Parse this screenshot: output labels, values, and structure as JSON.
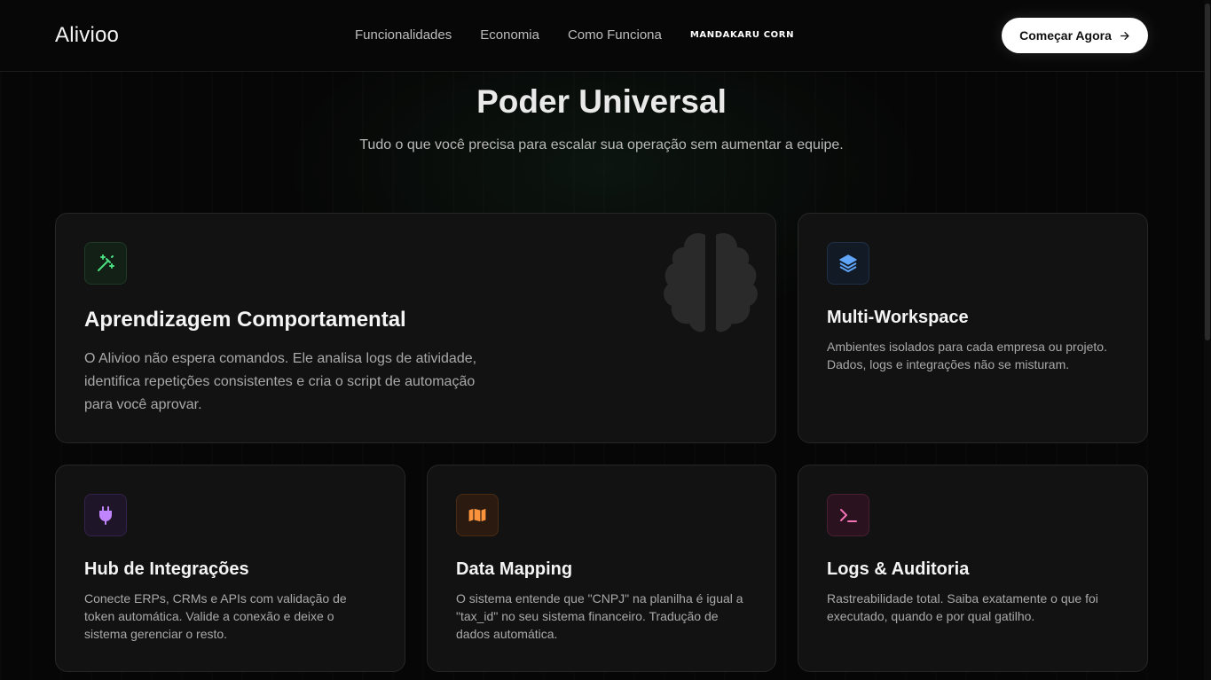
{
  "header": {
    "logo": "Alivioo",
    "nav": [
      {
        "label": "Funcionalidades"
      },
      {
        "label": "Economia"
      },
      {
        "label": "Como Funciona"
      },
      {
        "label": "MANDAKARU CORN"
      }
    ],
    "cta_label": "Começar Agora",
    "cta_icon": "arrow-right-icon"
  },
  "hero": {
    "title": "Poder Universal",
    "subtitle": "Tudo o que você precisa para escalar sua operação sem aumentar a equipe."
  },
  "cards": [
    {
      "title": "Aprendizagem Comportamental",
      "description": "O Alivioo não espera comandos. Ele analisa logs de atividade, identifica repetições consistentes e cria o script de automação para você aprovar.",
      "icon": "magic-wand-icon",
      "color": "#4ade80"
    },
    {
      "title": "Multi-Workspace",
      "description": "Ambientes isolados para cada empresa ou projeto. Dados, logs e integrações não se misturam.",
      "icon": "layers-icon",
      "color": "#60a5fa"
    },
    {
      "title": "Hub de Integrações",
      "description": "Conecte ERPs, CRMs e APIs com validação de token automática. Valide a conexão e deixe o sistema gerenciar o resto.",
      "icon": "plug-icon",
      "color": "#c084fc"
    },
    {
      "title": "Data Mapping",
      "description": "O sistema entende que \"CNPJ\" na planilha é igual a \"tax_id\" no seu sistema financeiro. Tradução de dados automática.",
      "icon": "map-icon",
      "color": "#fb923c"
    },
    {
      "title": "Logs & Auditoria",
      "description": "Rastreabilidade total. Saiba exatamente o que foi executado, quando e por qual gatilho.",
      "icon": "terminal-icon",
      "color": "#f472b6"
    }
  ],
  "colors": {
    "background": "#060606",
    "card": "#121212",
    "cta_background": "#ffffff"
  }
}
